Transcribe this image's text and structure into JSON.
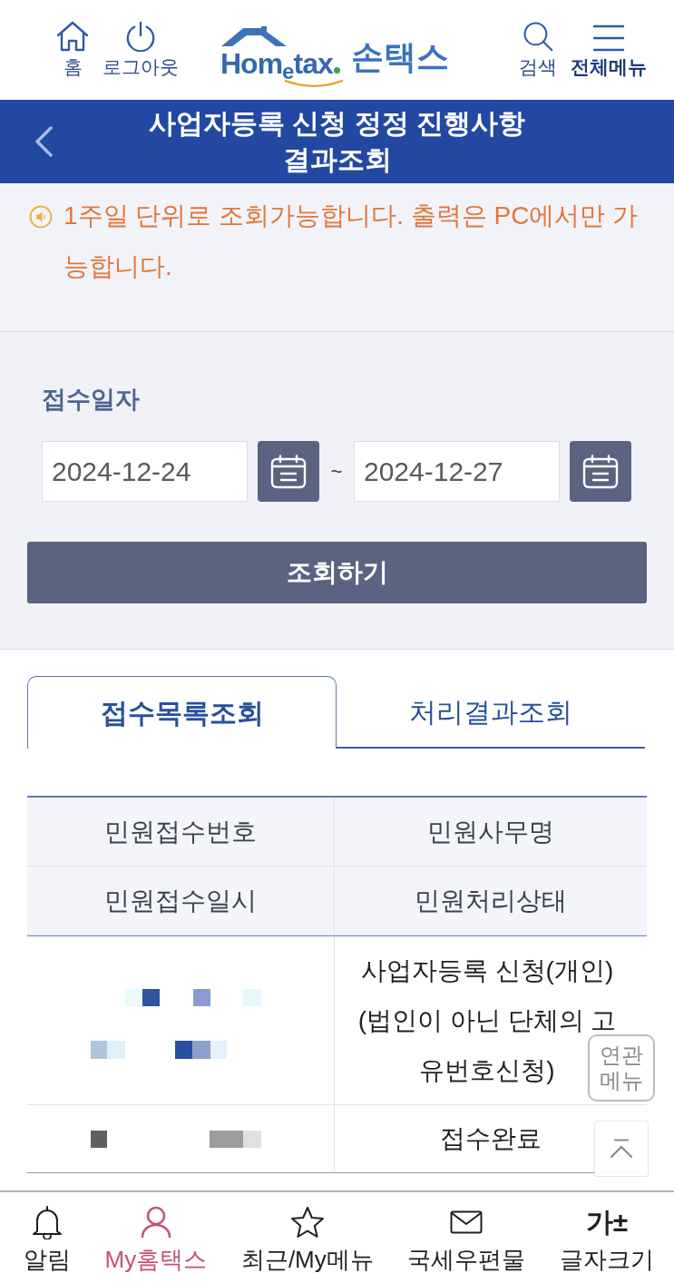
{
  "header": {
    "left_actions": [
      {
        "kind": "home",
        "label": "홈",
        "bold": false
      },
      {
        "kind": "power",
        "label": "로그아웃",
        "bold": false
      }
    ],
    "logo": {
      "wordmark": "Hom$_{e}$tax",
      "name": "손택스"
    },
    "right_actions": [
      {
        "kind": "search",
        "label": "검색",
        "bold": false
      },
      {
        "kind": "menu",
        "label": "전체메뉴",
        "bold": true
      }
    ]
  },
  "title_bar": {
    "title": "사업자등록 신청 정정 진행사항 결과조회"
  },
  "notice": {
    "text": "1주일 단위로 조회가능합니다. 출력은 PC에서만 가능합니다."
  },
  "date_filter": {
    "label": "접수일자",
    "from": "2024-12-24",
    "separator": "~",
    "to": "2024-12-27",
    "search_button": "조회하기"
  },
  "tabs": [
    {
      "label": "접수목록조회",
      "selected": true
    },
    {
      "label": "처리결과조회",
      "selected": false
    }
  ],
  "table": {
    "header_rows": [
      [
        "민원접수번호",
        "민원사무명"
      ],
      [
        "민원접수일시",
        "민원처리상태"
      ]
    ],
    "rows": [
      {
        "redacted": true,
        "value": "사업자등록 신청(개인)(법인이 아닌 단체의 고유번호신청)"
      },
      {
        "redacted": true,
        "value": "접수완료"
      }
    ]
  },
  "floating": {
    "related_menu": "연관 메뉴"
  },
  "bottom_nav": [
    {
      "kind": "bell",
      "label": "알림",
      "selected": false
    },
    {
      "kind": "person",
      "label": "My홈택스",
      "selected": true
    },
    {
      "kind": "star",
      "label": "최근/My메뉴",
      "selected": false
    },
    {
      "kind": "mail",
      "label": "국세우편물",
      "selected": false
    },
    {
      "kind": "glyph",
      "glyph": "가±",
      "label": "글자크기",
      "selected": false
    }
  ]
}
